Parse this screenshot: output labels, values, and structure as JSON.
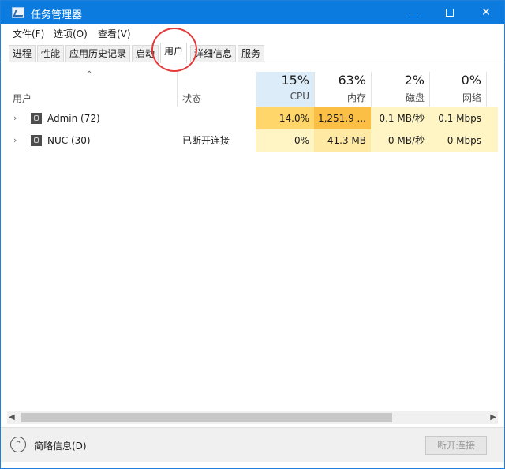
{
  "window": {
    "title": "任务管理器",
    "accent_color": "#0b7be0"
  },
  "menu": [
    {
      "label": "文件(F)"
    },
    {
      "label": "选项(O)"
    },
    {
      "label": "查看(V)"
    }
  ],
  "tabs": [
    {
      "label": "进程"
    },
    {
      "label": "性能"
    },
    {
      "label": "应用历史记录"
    },
    {
      "label": "启动"
    },
    {
      "label": "用户"
    },
    {
      "label": "详细信息"
    },
    {
      "label": "服务"
    }
  ],
  "active_tab": "用户",
  "table": {
    "headers": {
      "user": "用户",
      "status": "状态",
      "cpu": {
        "pct": "15%",
        "label": "CPU"
      },
      "memory": {
        "pct": "63%",
        "label": "内存"
      },
      "disk": {
        "pct": "2%",
        "label": "磁盘"
      },
      "network": {
        "pct": "0%",
        "label": "网络"
      }
    },
    "rows": [
      {
        "user": "Admin (72)",
        "status": "",
        "cpu": "14.0%",
        "memory": "1,251.9 ...",
        "disk": "0.1 MB/秒",
        "network": "0.1 Mbps"
      },
      {
        "user": "NUC (30)",
        "status": "已断开连接",
        "cpu": "0%",
        "memory": "41.3 MB",
        "disk": "0 MB/秒",
        "network": "0 Mbps"
      }
    ],
    "heat_colors": {
      "low": "#fff4c4",
      "mid": "#ffe9a3",
      "high": "#ffd66a",
      "hot": "#fbbf45"
    }
  },
  "footer": {
    "fewer_details": "简略信息(D)",
    "disconnect_button": "断开连接"
  },
  "icons": {
    "app": "task-manager-icon",
    "expand": "chevron-right-icon",
    "user": "user-icon",
    "sort": "sort-up-icon",
    "fewer": "chevron-up-circle-icon"
  }
}
